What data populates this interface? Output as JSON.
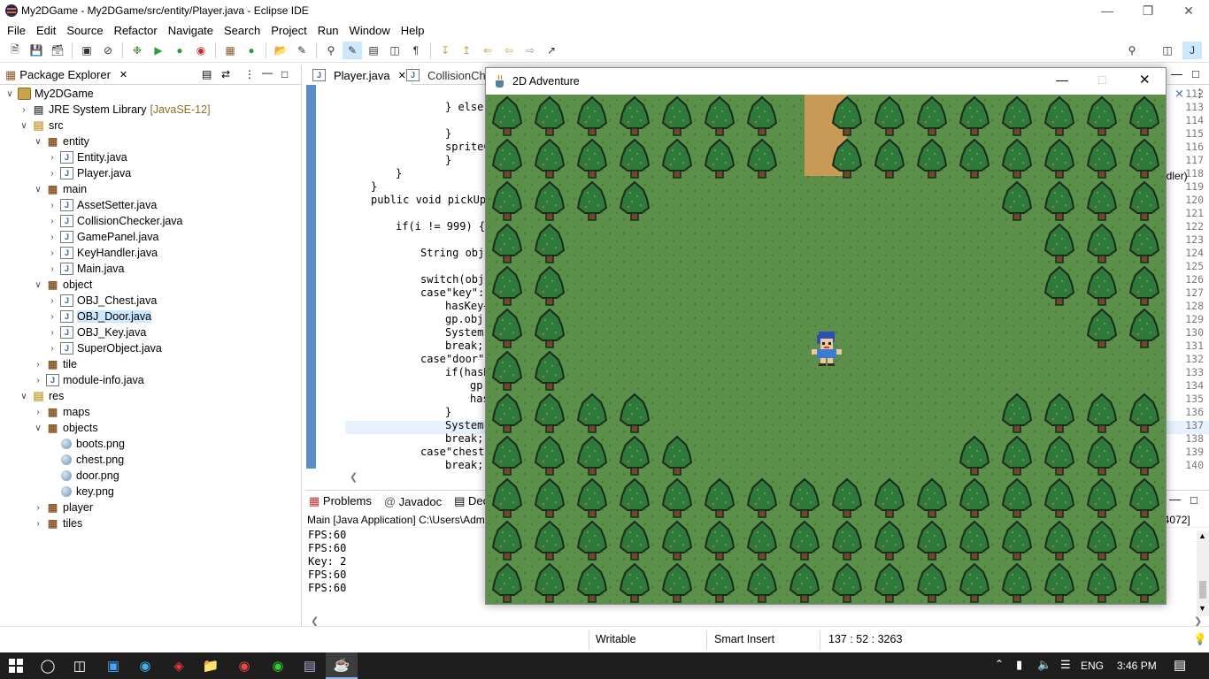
{
  "window": {
    "title": "My2DGame - My2DGame/src/entity/Player.java - Eclipse IDE"
  },
  "menu": [
    "File",
    "Edit",
    "Source",
    "Refactor",
    "Navigate",
    "Search",
    "Project",
    "Run",
    "Window",
    "Help"
  ],
  "package_explorer": {
    "tab_label": "Package Explorer",
    "tree": [
      {
        "label": "My2DGame",
        "type": "project",
        "level": 0,
        "expanded": true
      },
      {
        "label": "JRE System Library",
        "suffix": "[JavaSE-12]",
        "type": "lib",
        "level": 1,
        "expanded": false
      },
      {
        "label": "src",
        "type": "folder",
        "level": 1,
        "expanded": true
      },
      {
        "label": "entity",
        "type": "pkg",
        "level": 2,
        "expanded": true
      },
      {
        "label": "Entity.java",
        "type": "java",
        "level": 3
      },
      {
        "label": "Player.java",
        "type": "java",
        "level": 3
      },
      {
        "label": "main",
        "type": "pkg",
        "level": 2,
        "expanded": true
      },
      {
        "label": "AssetSetter.java",
        "type": "java",
        "level": 3
      },
      {
        "label": "CollisionChecker.java",
        "type": "java",
        "level": 3
      },
      {
        "label": "GamePanel.java",
        "type": "java",
        "level": 3
      },
      {
        "label": "KeyHandler.java",
        "type": "java",
        "level": 3
      },
      {
        "label": "Main.java",
        "type": "java",
        "level": 3
      },
      {
        "label": "object",
        "type": "pkg",
        "level": 2,
        "expanded": true
      },
      {
        "label": "OBJ_Chest.java",
        "type": "java",
        "level": 3
      },
      {
        "label": "OBJ_Door.java",
        "type": "java",
        "level": 3,
        "selected": true
      },
      {
        "label": "OBJ_Key.java",
        "type": "java",
        "level": 3
      },
      {
        "label": "SuperObject.java",
        "type": "java",
        "level": 3
      },
      {
        "label": "tile",
        "type": "pkg",
        "level": 2,
        "expanded": false
      },
      {
        "label": "module-info.java",
        "type": "java",
        "level": 2
      },
      {
        "label": "res",
        "type": "folder",
        "level": 1,
        "expanded": true
      },
      {
        "label": "maps",
        "type": "pkg",
        "level": 2,
        "expanded": false
      },
      {
        "label": "objects",
        "type": "pkg",
        "level": 2,
        "expanded": true
      },
      {
        "label": "boots.png",
        "type": "png",
        "level": 3
      },
      {
        "label": "chest.png",
        "type": "png",
        "level": 3
      },
      {
        "label": "door.png",
        "type": "png",
        "level": 3
      },
      {
        "label": "key.png",
        "type": "png",
        "level": 3
      },
      {
        "label": "player",
        "type": "pkg",
        "level": 2,
        "expanded": false
      },
      {
        "label": "tiles",
        "type": "pkg",
        "level": 2,
        "expanded": false
      }
    ]
  },
  "editor": {
    "tabs": [
      "Player.java",
      "CollisionCh..."
    ],
    "lines": [
      {
        "n": "112",
        "indent": 6,
        "text": "spriteN"
      },
      {
        "n": "113",
        "indent": 4,
        "text": "} else if"
      },
      {
        "n": "114",
        "indent": 6,
        "text": "spriteN"
      },
      {
        "n": "115",
        "indent": 4,
        "text": "}"
      },
      {
        "n": "116",
        "indent": 4,
        "text": "spriteCount"
      },
      {
        "n": "117",
        "indent": 4,
        "text": "}"
      },
      {
        "n": "118",
        "indent": 2,
        "text": "}"
      },
      {
        "n": "119",
        "indent": 1,
        "text": "}"
      },
      {
        "n": "120",
        "indent": 1,
        "text": "public void pickUpC"
      },
      {
        "n": "121",
        "indent": 0,
        "text": ""
      },
      {
        "n": "122",
        "indent": 2,
        "text": "if(i != 999) {"
      },
      {
        "n": "123",
        "indent": 0,
        "text": ""
      },
      {
        "n": "124",
        "indent": 3,
        "text": "String obje"
      },
      {
        "n": "125",
        "indent": 0,
        "text": ""
      },
      {
        "n": "126",
        "indent": 3,
        "text": "switch(obje"
      },
      {
        "n": "127",
        "indent": 3,
        "text": "case\"key\":"
      },
      {
        "n": "128",
        "indent": 4,
        "text": "hasKey+"
      },
      {
        "n": "129",
        "indent": 4,
        "text": "gp.obj["
      },
      {
        "n": "130",
        "indent": 4,
        "text": "System."
      },
      {
        "n": "131",
        "indent": 4,
        "text": "break;"
      },
      {
        "n": "132",
        "indent": 3,
        "text": "case\"door\":"
      },
      {
        "n": "133",
        "indent": 4,
        "text": "if(hasK"
      },
      {
        "n": "134",
        "indent": 5,
        "text": "gp."
      },
      {
        "n": "135",
        "indent": 5,
        "text": "has"
      },
      {
        "n": "136",
        "indent": 4,
        "text": "}"
      },
      {
        "n": "137",
        "indent": 4,
        "text": "System."
      },
      {
        "n": "138",
        "indent": 4,
        "text": "break;"
      },
      {
        "n": "139",
        "indent": 3,
        "text": "case\"chest\""
      },
      {
        "n": "140",
        "indent": 4,
        "text": "break;"
      }
    ],
    "right_edge_fragment": "ndler)"
  },
  "bottom_panel": {
    "tabs": [
      "Problems",
      "Javadoc",
      "Decla"
    ],
    "console_header": "Main [Java Application] C:\\Users\\Adm",
    "console_header_right": ": 4072]",
    "console_lines": [
      "FPS:60",
      "FPS:60",
      "Key: 2",
      "FPS:60",
      "FPS:60"
    ]
  },
  "status_bar": {
    "mode": "Writable",
    "insert": "Smart Insert",
    "position": "137 : 52 : 3263"
  },
  "game_window": {
    "title": "2D Adventure",
    "colors": {
      "grass": "#5c8f4a",
      "path": "#c99a55",
      "tree": "#2f7a3a"
    }
  },
  "taskbar": {
    "lang": "ENG",
    "time": "3:46 PM"
  }
}
